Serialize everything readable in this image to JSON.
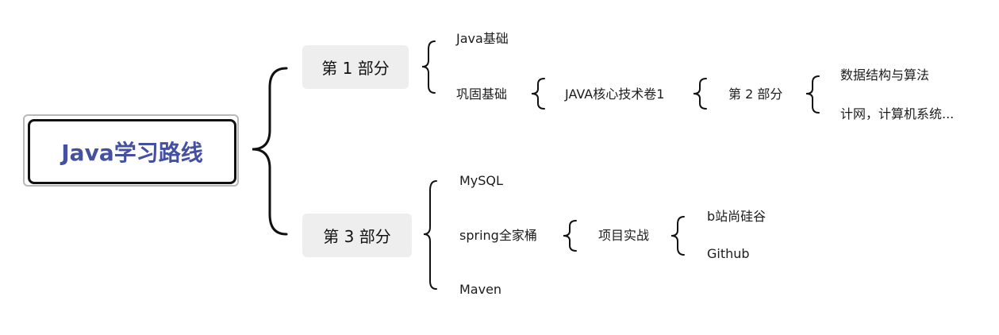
{
  "root": {
    "title": "Java学习路线"
  },
  "part1": {
    "label": "第 1 部分",
    "children": {
      "java_basics": "Java基础",
      "consolidate": "巩固基础"
    },
    "consolidate_path": {
      "book": "JAVA核心技术卷1",
      "part2": "第 2 部分",
      "part2_children": [
        "数据结构与算法",
        "计网，计算机系统..."
      ]
    }
  },
  "part3": {
    "label": "第 3 部分",
    "children": {
      "mysql": "MySQL",
      "spring": "spring全家桶",
      "maven": "Maven"
    },
    "spring_path": {
      "project": "项目实战",
      "project_children": [
        "b站尚硅谷",
        "Github"
      ]
    }
  },
  "colors": {
    "root_text": "#4450a0",
    "node_bg": "#eeeeee",
    "bracket": "#111111"
  }
}
